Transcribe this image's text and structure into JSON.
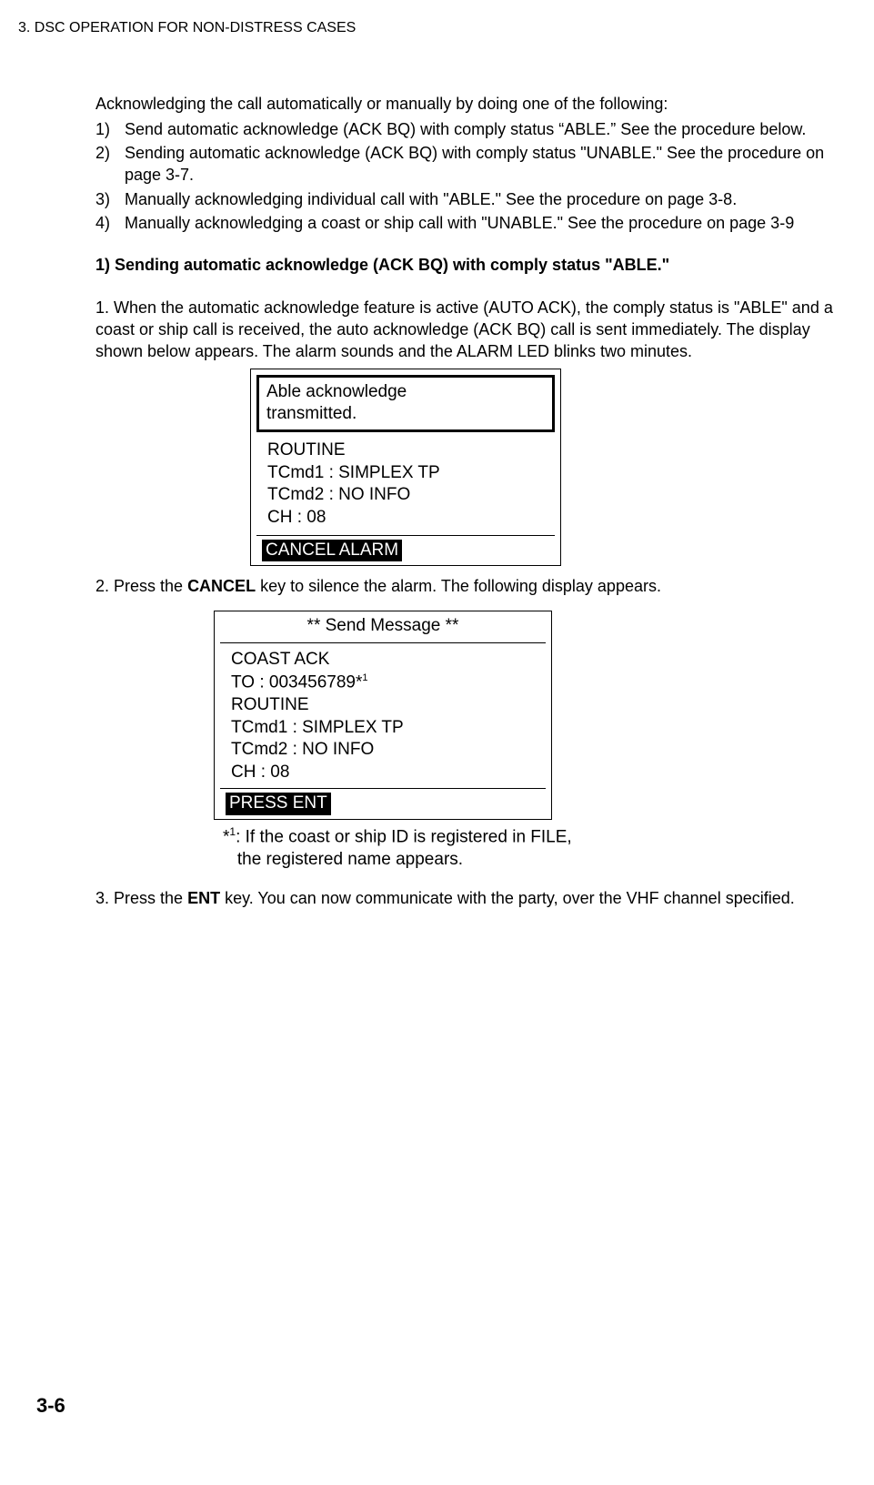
{
  "header": "3. DSC OPERATION FOR NON-DISTRESS CASES",
  "intro": "Acknowledging the call automatically or manually by doing one of the following:",
  "options": [
    {
      "num": "1)",
      "text": "Send automatic acknowledge (ACK BQ) with comply status “ABLE.” See the procedure below."
    },
    {
      "num": "2)",
      "text": "Sending automatic acknowledge (ACK BQ) with comply status \"UNABLE.\" See the procedure on page 3-7."
    },
    {
      "num": "3)",
      "text": "Manually acknowledging individual call with \"ABLE.\" See the procedure on page 3-8."
    },
    {
      "num": "4)",
      "text": "Manually acknowledging a coast or ship call with \"UNABLE.\" See the procedure on page 3-9"
    }
  ],
  "section1_heading": "1) Sending automatic acknowledge (ACK BQ) with comply status \"ABLE.\"",
  "step1": {
    "prefix": "1. ",
    "body": "When the automatic acknowledge feature is active (AUTO ACK), the comply status is \"ABLE\" and a coast or ship call is received, the auto acknowledge (ACK BQ) call is sent immediately. The display shown below appears. The alarm sounds and the ALARM LED blinks two minutes."
  },
  "display1": {
    "box_l1": "Able acknowledge",
    "box_l2": "transmitted.",
    "l1": "ROUTINE",
    "l2": "TCmd1 : SIMPLEX TP",
    "l3": "TCmd2 : NO INFO",
    "l4": "CH : 08",
    "footer": "CANCEL ALARM"
  },
  "step2": {
    "prefix": "2. Press the ",
    "key": "CANCEL",
    "suffix": " key to silence the alarm. The following display appears."
  },
  "display2": {
    "title": "** Send Message **",
    "l1": "COAST ACK",
    "l2a": "TO : 003456789*",
    "l2b": "1",
    "l3": "ROUTINE",
    "l4": "TCmd1 : SIMPLEX TP",
    "l5": "TCmd2 : NO INFO",
    "l6": "CH : 08",
    "footer": "PRESS ENT"
  },
  "footnote": {
    "mark_a": "*",
    "mark_b": "1",
    "text_a": ": If the coast or ship ID is registered in FILE,",
    "text_b": "the registered name appears."
  },
  "step3": {
    "prefix": "3. Press the ",
    "key": "ENT",
    "suffix": " key. You can now communicate with the party, over the VHF channel specified."
  },
  "page_num": "3-6"
}
